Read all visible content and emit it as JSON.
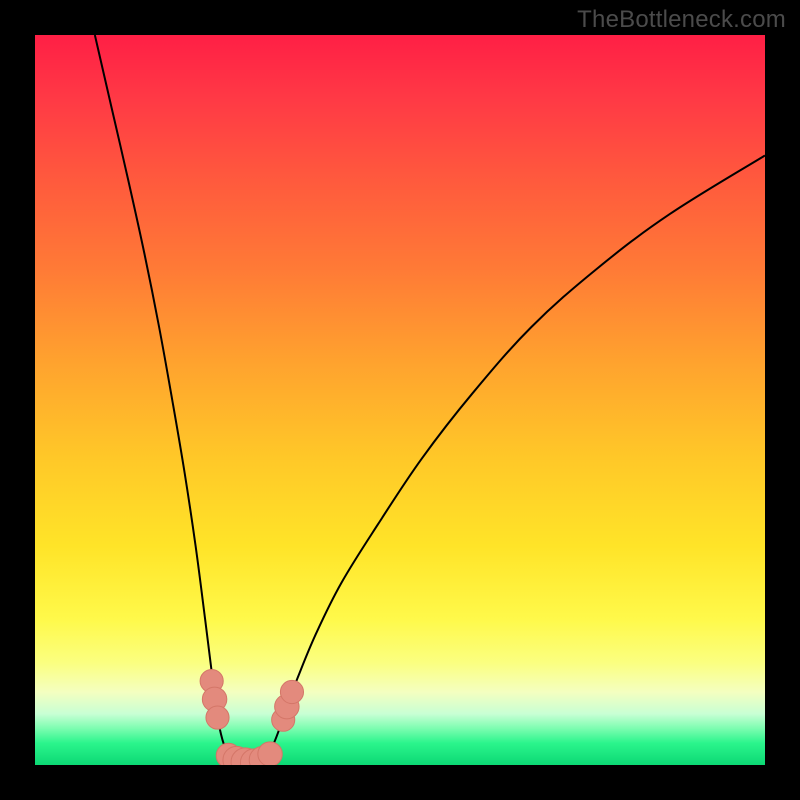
{
  "watermark": "TheBottleneck.com",
  "colors": {
    "marker": "#e38a7d",
    "curve": "#000000",
    "background_top": "#ff1f45",
    "background_bottom": "#0cd874"
  },
  "chart_data": {
    "type": "line",
    "title": "",
    "xlabel": "",
    "ylabel": "",
    "xlim": [
      0,
      100
    ],
    "ylim": [
      0,
      100
    ],
    "grid": false,
    "legend": false,
    "annotations": [],
    "curves": [
      {
        "name": "left-branch",
        "points": [
          {
            "x": 8.2,
            "y": 100.0
          },
          {
            "x": 10.5,
            "y": 90.0
          },
          {
            "x": 12.8,
            "y": 80.0
          },
          {
            "x": 15.0,
            "y": 70.0
          },
          {
            "x": 17.0,
            "y": 60.0
          },
          {
            "x": 18.8,
            "y": 50.0
          },
          {
            "x": 20.5,
            "y": 40.0
          },
          {
            "x": 22.0,
            "y": 30.0
          },
          {
            "x": 23.3,
            "y": 20.0
          },
          {
            "x": 24.3,
            "y": 12.0
          },
          {
            "x": 24.8,
            "y": 8.0
          },
          {
            "x": 25.3,
            "y": 5.0
          },
          {
            "x": 26.0,
            "y": 2.5
          },
          {
            "x": 27.0,
            "y": 1.0
          },
          {
            "x": 28.5,
            "y": 0.3
          }
        ]
      },
      {
        "name": "right-branch",
        "points": [
          {
            "x": 30.0,
            "y": 0.3
          },
          {
            "x": 31.5,
            "y": 1.0
          },
          {
            "x": 32.5,
            "y": 2.5
          },
          {
            "x": 33.5,
            "y": 5.0
          },
          {
            "x": 34.5,
            "y": 8.0
          },
          {
            "x": 36.0,
            "y": 12.0
          },
          {
            "x": 38.5,
            "y": 18.0
          },
          {
            "x": 42.0,
            "y": 25.0
          },
          {
            "x": 47.0,
            "y": 33.0
          },
          {
            "x": 53.0,
            "y": 42.0
          },
          {
            "x": 60.0,
            "y": 51.0
          },
          {
            "x": 68.0,
            "y": 60.0
          },
          {
            "x": 77.0,
            "y": 68.0
          },
          {
            "x": 87.0,
            "y": 75.5
          },
          {
            "x": 100.0,
            "y": 83.5
          }
        ]
      }
    ],
    "markers": [
      {
        "x": 24.2,
        "y": 11.5,
        "r": 1.0
      },
      {
        "x": 24.6,
        "y": 9.0,
        "r": 1.1
      },
      {
        "x": 25.0,
        "y": 6.5,
        "r": 1.0
      },
      {
        "x": 26.5,
        "y": 1.3,
        "r": 1.1
      },
      {
        "x": 27.6,
        "y": 0.7,
        "r": 1.3
      },
      {
        "x": 28.8,
        "y": 0.4,
        "r": 1.4
      },
      {
        "x": 30.0,
        "y": 0.35,
        "r": 1.3
      },
      {
        "x": 31.2,
        "y": 0.7,
        "r": 1.3
      },
      {
        "x": 32.2,
        "y": 1.5,
        "r": 1.1
      },
      {
        "x": 34.0,
        "y": 6.2,
        "r": 1.0
      },
      {
        "x": 34.5,
        "y": 8.0,
        "r": 1.1
      },
      {
        "x": 35.2,
        "y": 10.0,
        "r": 1.0
      }
    ]
  }
}
